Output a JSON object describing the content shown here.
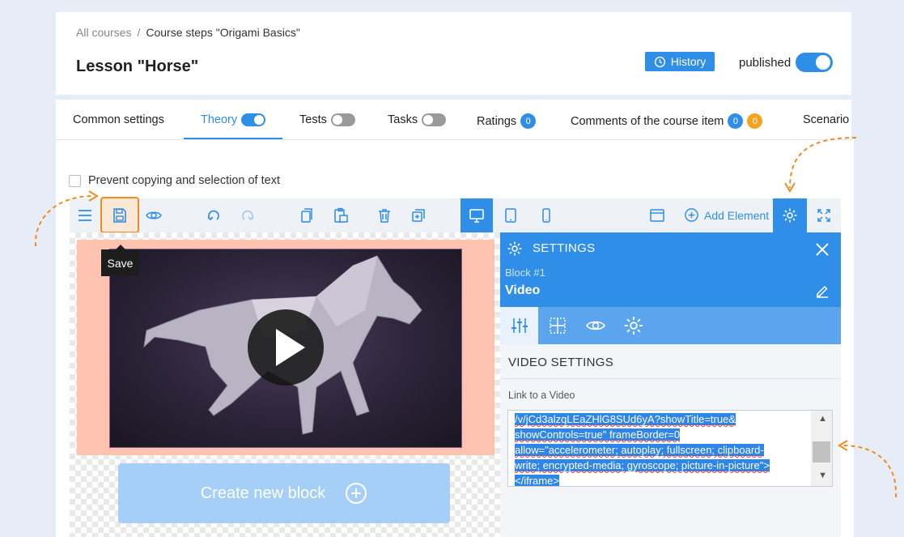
{
  "breadcrumb": {
    "root": "All courses",
    "separator": "/",
    "current": "Course steps \"Origami Basics\""
  },
  "lesson": {
    "title": "Lesson \"Horse\""
  },
  "header": {
    "history_label": "History",
    "published_label": "published",
    "published": true
  },
  "tabs": [
    {
      "label": "Common settings"
    },
    {
      "label": "Theory",
      "active": true,
      "toggle": true
    },
    {
      "label": "Tests",
      "toggle": false
    },
    {
      "label": "Tasks",
      "toggle": false
    },
    {
      "label": "Ratings",
      "badge": "0"
    },
    {
      "label": "Comments of the course item",
      "badge": "0",
      "badge2": "0"
    },
    {
      "label": "Scenario"
    }
  ],
  "options": {
    "prevent_copy_label": "Prevent copying and selection of text",
    "prevent_copy_checked": false
  },
  "toolbar": {
    "add_element_label": "Add Element",
    "save_tooltip": "Save",
    "icons": [
      "menu-icon",
      "save-icon",
      "preview-eye-icon",
      "undo-icon",
      "redo-icon",
      "copy-icon",
      "paste-icon",
      "delete-icon",
      "duplicate-icon",
      "desktop-icon",
      "tablet-icon",
      "mobile-icon",
      "window-icon",
      "add-circle-icon",
      "settings-gear-icon",
      "fullscreen-icon"
    ]
  },
  "canvas": {
    "create_block_label": "Create new block"
  },
  "settings_panel": {
    "title": "SETTINGS",
    "block_label": "Block #1",
    "block_name": "Video",
    "section_title": "VIDEO SETTINGS",
    "field_label": "Link to a Video",
    "field_lines": [
      "/v/jCd3alzqLEaZHlG8SUd6yA?showTitle=true&",
      "showControls=true\" frameBorder=0",
      "allow=\"accelerometer; autoplay; fullscreen; clipboard-",
      "write; encrypted-media; gyroscope; picture-in-picture\">",
      "</iframe>"
    ]
  },
  "colors": {
    "accent": "#2f8ee8",
    "highlight": "#f08a24",
    "video_block_bg": "#fdc3ae",
    "badge_orange": "#f4a21f"
  }
}
